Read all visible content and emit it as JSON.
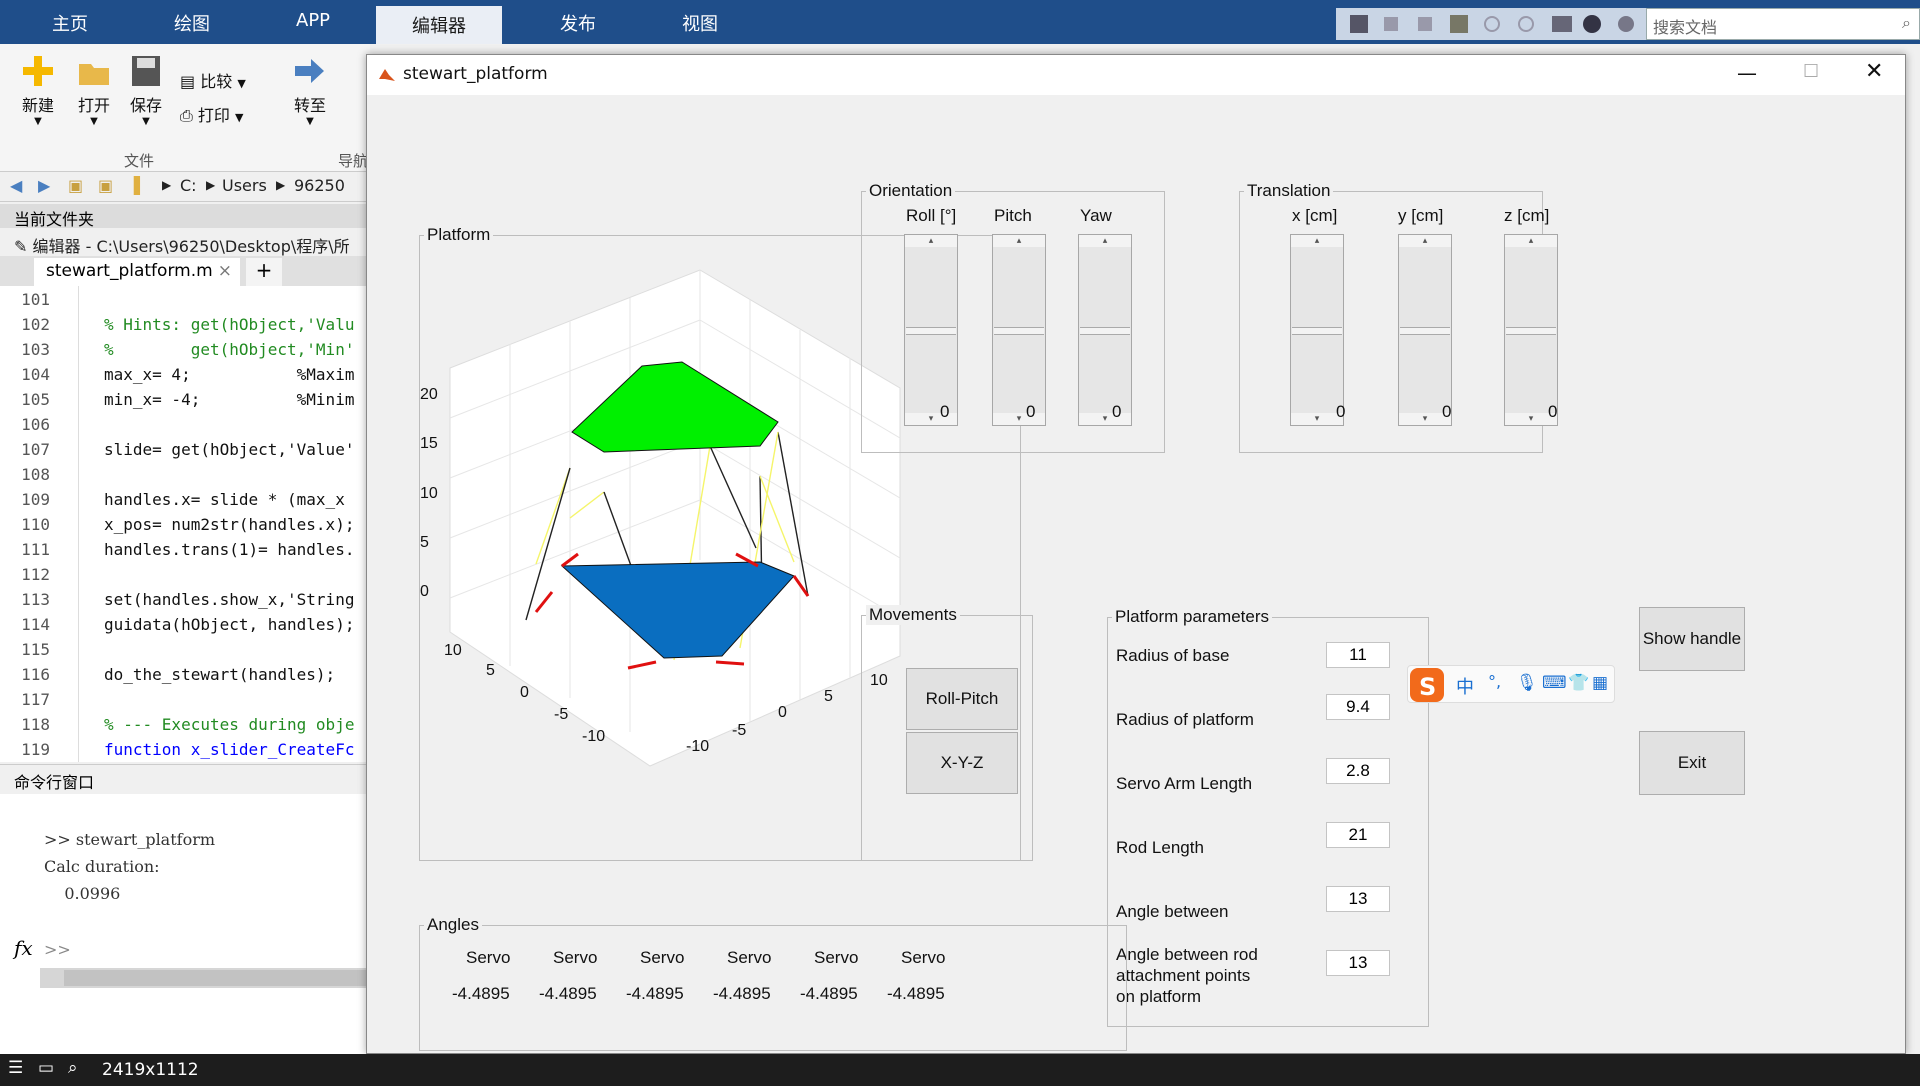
{
  "ribbon": {
    "tabs": [
      "主页",
      "绘图",
      "APP",
      "编辑器",
      "发布",
      "视图"
    ],
    "active": "编辑器",
    "search_placeholder": "搜索文档",
    "buttons": {
      "new": "新建",
      "open": "打开",
      "save": "保存",
      "compare": "比较",
      "print": "打印",
      "goto": "转至",
      "group_file": "文件",
      "group_nav": "导航"
    }
  },
  "address": {
    "parts": [
      "C:",
      "Users",
      "96250"
    ]
  },
  "current_folder": "当前文件夹",
  "editor": {
    "title": "编辑器 - C:\\Users\\96250\\Desktop\\程序\\所",
    "tab": "stewart_platform.m",
    "close": "×",
    "add": "+",
    "lines": [
      {
        "n": "101",
        "t": "",
        "c": ""
      },
      {
        "n": "102",
        "t": "% Hints: get(hObject,'Valu",
        "c": "cm"
      },
      {
        "n": "103",
        "t": "%        get(hObject,'Min'",
        "c": "cm"
      },
      {
        "n": "104",
        "t": "max_x= 4;           %Maxim",
        "c": ""
      },
      {
        "n": "105",
        "t": "min_x= -4;          %Minim",
        "c": ""
      },
      {
        "n": "106",
        "t": "",
        "c": ""
      },
      {
        "n": "107",
        "t": "slide= get(hObject,'Value'",
        "c": ""
      },
      {
        "n": "108",
        "t": "",
        "c": ""
      },
      {
        "n": "109",
        "t": "handles.x= slide * (max_x",
        "c": ""
      },
      {
        "n": "110",
        "t": "x_pos= num2str(handles.x);",
        "c": ""
      },
      {
        "n": "111",
        "t": "handles.trans(1)= handles.",
        "c": ""
      },
      {
        "n": "112",
        "t": "",
        "c": ""
      },
      {
        "n": "113",
        "t": "set(handles.show_x,'String",
        "c": ""
      },
      {
        "n": "114",
        "t": "guidata(hObject, handles);",
        "c": ""
      },
      {
        "n": "115",
        "t": "",
        "c": ""
      },
      {
        "n": "116",
        "t": "do_the_stewart(handles);",
        "c": ""
      },
      {
        "n": "117",
        "t": "",
        "c": ""
      },
      {
        "n": "118",
        "t": "% --- Executes during obje",
        "c": "cm"
      },
      {
        "n": "119",
        "t": "function x_slider_CreateFc",
        "c": "kw"
      }
    ]
  },
  "command": {
    "title": "命令行窗口",
    "lines": [
      ">> stewart_platform",
      "Calc duration:",
      "    0.0996"
    ],
    "prompt": ">>",
    "fx": "fx"
  },
  "figure": {
    "title": "stewart_platform",
    "platform_panel": "Platform",
    "axes": {
      "z_ticks": [
        "20",
        "15",
        "10",
        "5",
        "0"
      ],
      "x_ticks": [
        "10",
        "5",
        "0",
        "-5",
        "-10"
      ],
      "y_ticks": [
        "10",
        "5",
        "0",
        "-5",
        "-10"
      ]
    },
    "orientation": {
      "title": "Orientation",
      "labels": [
        "Roll [°]",
        "Pitch",
        "Yaw"
      ],
      "values": [
        "0",
        "0",
        "0"
      ]
    },
    "translation": {
      "title": "Translation",
      "labels": [
        "x [cm]",
        "y [cm]",
        "z [cm]"
      ],
      "values": [
        "0",
        "0",
        "0"
      ]
    },
    "movements": {
      "title": "Movements",
      "buttons": [
        "Roll-Pitch",
        "X-Y-Z"
      ]
    },
    "params": {
      "title": "Platform parameters",
      "rows": [
        {
          "label": "Radius of base",
          "value": "11"
        },
        {
          "label": "Radius of platform",
          "value": "9.4"
        },
        {
          "label": "Servo Arm Length",
          "value": "2.8"
        },
        {
          "label": "Rod Length",
          "value": "21"
        },
        {
          "label": "Angle between",
          "value": "13"
        },
        {
          "label": "Angle between rod\nattachment points\non platform",
          "value": "13"
        }
      ]
    },
    "show_handle": "Show handle",
    "exit": "Exit",
    "angles": {
      "title": "Angles",
      "labels": [
        "Servo",
        "Servo",
        "Servo",
        "Servo",
        "Servo",
        "Servo"
      ],
      "values": [
        "-4.4895",
        "-4.4895",
        "-4.4895",
        "-4.4895",
        "-4.4895",
        "-4.4895"
      ]
    }
  },
  "ime": {
    "lang": "中",
    "punct": "°,"
  },
  "status": {
    "resolution": "2419x1112"
  }
}
